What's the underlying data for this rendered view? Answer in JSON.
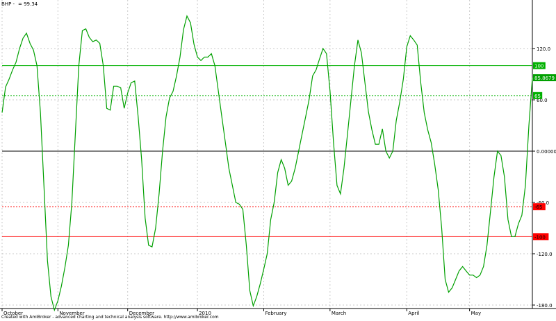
{
  "header": {
    "symbol": "BHP -",
    "value_text": "= 99.34"
  },
  "footer": {
    "credit": "Created with AmiBroker - advanced charting and technical analysis software. http://www.amibroker.com"
  },
  "colors": {
    "series": "#00a000",
    "overbought": "#00b000",
    "oversold": "#ff0000",
    "zero": "#000000",
    "grid": "#c8c8c8",
    "background": "#ffffff"
  },
  "chart_data": {
    "type": "line",
    "ylim": [
      -185,
      160
    ],
    "y_ticks": [
      {
        "value": 120,
        "label": "120.0"
      },
      {
        "value": 60,
        "label": "60.0"
      },
      {
        "value": 0,
        "label": "0.00000"
      },
      {
        "value": -60,
        "label": "-60.0"
      },
      {
        "value": -120,
        "label": "-120.0"
      },
      {
        "value": -180,
        "label": "-180.0"
      }
    ],
    "month_labels": [
      {
        "label": "October",
        "pos": 0
      },
      {
        "label": "November",
        "pos": 16
      },
      {
        "label": "December",
        "pos": 36
      },
      {
        "label": "2010",
        "pos": 56
      },
      {
        "label": "February",
        "pos": 75
      },
      {
        "label": "March",
        "pos": 94
      },
      {
        "label": "April",
        "pos": 116
      },
      {
        "label": "May",
        "pos": 134
      }
    ],
    "reference_lines": [
      {
        "value": 100,
        "label": "100",
        "color": "#00b000",
        "style": "solid"
      },
      {
        "value": 65,
        "label": "65",
        "color": "#00b000",
        "style": "dotted"
      },
      {
        "value": 0,
        "label": "0.00000",
        "color": "#000000",
        "style": "solid"
      },
      {
        "value": -65,
        "label": "-65",
        "color": "#ff0000",
        "style": "dotted"
      },
      {
        "value": -100,
        "label": "-100",
        "color": "#ff0000",
        "style": "solid"
      }
    ],
    "last_value_label": "85.8679",
    "series": [
      {
        "values": [
          45,
          75,
          84,
          95,
          104,
          120,
          132,
          138,
          126,
          118,
          100,
          45,
          -40,
          -128,
          -170,
          -186,
          -175,
          -158,
          -136,
          -110,
          -60,
          20,
          100,
          141,
          143,
          133,
          128,
          130,
          126,
          100,
          50,
          48,
          76,
          76,
          74,
          50,
          68,
          80,
          82,
          40,
          -10,
          -78,
          -110,
          -112,
          -90,
          -50,
          0,
          40,
          62,
          70,
          88,
          110,
          142,
          158,
          150,
          125,
          110,
          106,
          110,
          110,
          114,
          100,
          70,
          40,
          10,
          -20,
          -40,
          -60,
          -62,
          -68,
          -110,
          -163,
          -181,
          -170,
          -155,
          -138,
          -120,
          -80,
          -60,
          -25,
          -10,
          -20,
          -40,
          -35,
          -20,
          0,
          20,
          40,
          60,
          88,
          95,
          108,
          120,
          114,
          70,
          10,
          -40,
          -50,
          -20,
          20,
          60,
          100,
          130,
          115,
          80,
          46,
          25,
          8,
          8,
          26,
          0,
          -8,
          0,
          36,
          58,
          84,
          122,
          135,
          130,
          124,
          80,
          45,
          25,
          10,
          -15,
          -45,
          -90,
          -150,
          -165,
          -160,
          -150,
          -140,
          -135,
          -140,
          -145,
          -145,
          -148,
          -145,
          -135,
          -110,
          -70,
          -30,
          0,
          -5,
          -30,
          -80,
          -100,
          -100,
          -85,
          -75,
          -40,
          30,
          85.87
        ]
      }
    ]
  }
}
